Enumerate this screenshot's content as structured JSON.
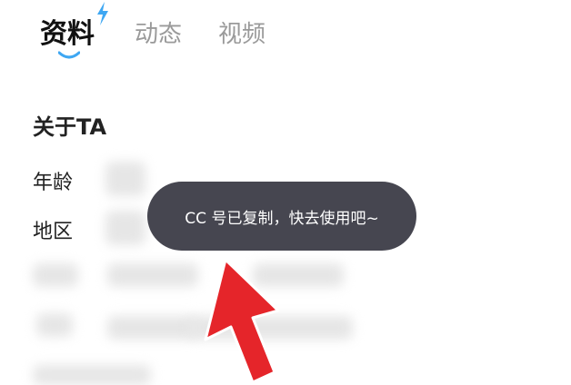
{
  "tabs": [
    {
      "label": "资料",
      "active": true
    },
    {
      "label": "动态",
      "active": false
    },
    {
      "label": "视频",
      "active": false
    }
  ],
  "about": {
    "title": "关于TA",
    "rows": [
      {
        "label": "年龄"
      },
      {
        "label": "地区"
      }
    ]
  },
  "toast": {
    "message": "CC 号已复制，快去使用吧~"
  },
  "colors": {
    "toast_bg": "#464650",
    "accent_bolt": "#3ea7f2",
    "arrow": "#e5252a",
    "inactive_tab": "#9a9a9a"
  },
  "icons": [
    "lightning-bolt-icon",
    "red-arrow-annotation"
  ]
}
